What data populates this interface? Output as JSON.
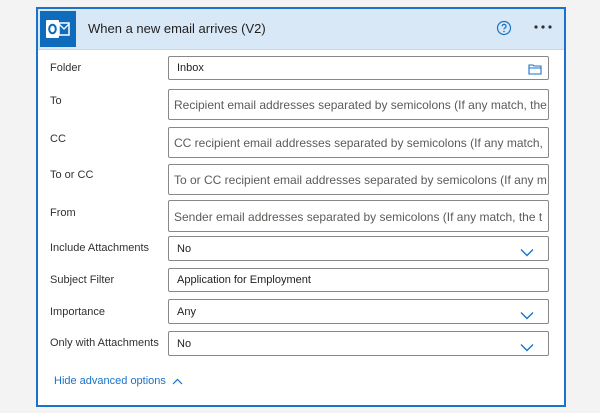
{
  "header": {
    "title": "When a new email arrives (V2)",
    "logo_icon": "outlook-icon",
    "help_icon": "help-circle-icon",
    "more_icon": "more-ellipsis-icon"
  },
  "fields": {
    "folder": {
      "label": "Folder",
      "value": "Inbox",
      "icon": "folder-icon"
    },
    "to": {
      "label": "To",
      "placeholder": "Recipient email addresses separated by semicolons (If any match, the"
    },
    "cc": {
      "label": "CC",
      "placeholder": "CC recipient email addresses separated by semicolons (If any match,"
    },
    "to_or_cc": {
      "label": "To or CC",
      "placeholder": "To or CC recipient email addresses separated by semicolons (If any m"
    },
    "from": {
      "label": "From",
      "placeholder": "Sender email addresses separated by semicolons (If any match, the t"
    },
    "include_attachments": {
      "label": "Include Attachments",
      "value": "No"
    },
    "subject_filter": {
      "label": "Subject Filter",
      "value": "Application for Employment"
    },
    "importance": {
      "label": "Importance",
      "value": "Any"
    },
    "only_with_attachments": {
      "label": "Only with Attachments",
      "value": "No"
    }
  },
  "advanced": {
    "label": "Hide advanced options",
    "icon": "chevron-up-icon"
  },
  "colors": {
    "accent": "#1b72c9",
    "header_bg": "#d9e8f6",
    "logo_bg": "#0f6cbd"
  }
}
